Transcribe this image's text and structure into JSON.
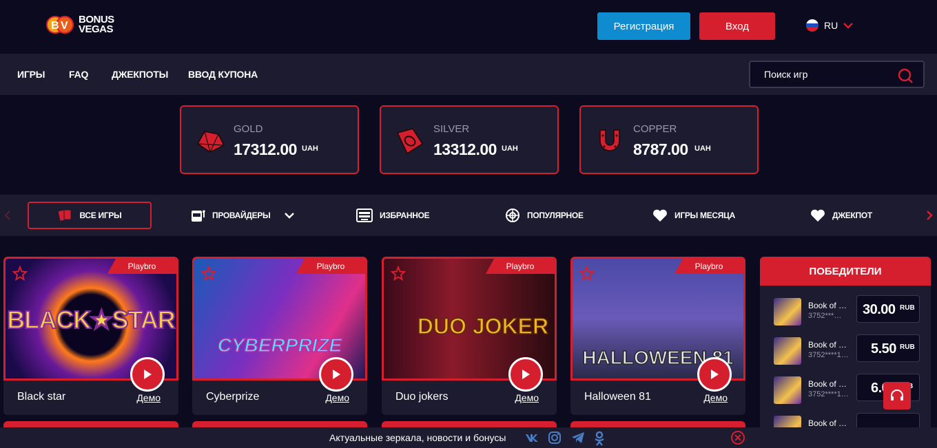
{
  "header": {
    "logo_line1": "BONUS",
    "logo_line2": "VEGAS",
    "register_label": "Регистрация",
    "login_label": "Вход",
    "language": "RU"
  },
  "nav": {
    "items": [
      "ИГРЫ",
      "FAQ",
      "ДЖЕКПОТЫ",
      "ВВОД КУПОНА"
    ],
    "search_placeholder": "Поиск игр"
  },
  "jackpots": [
    {
      "label": "GOLD",
      "value": "17312.00",
      "currency": "UAH",
      "icon": "diamond-icon"
    },
    {
      "label": "SILVER",
      "value": "13312.00",
      "currency": "UAH",
      "icon": "ring-icon"
    },
    {
      "label": "COPPER",
      "value": "8787.00",
      "currency": "UAH",
      "icon": "horseshoe-icon"
    }
  ],
  "categories": [
    {
      "label": "ВСЕ ИГРЫ",
      "icon": "cards-icon",
      "active": true
    },
    {
      "label": "ПРОВАЙДЕРЫ",
      "icon": "slot-machine-icon"
    },
    {
      "label": "ИЗБРАННОЕ",
      "icon": "keyboard-icon"
    },
    {
      "label": "ПОПУЛЯРНОЕ",
      "icon": "globe-icon"
    },
    {
      "label": "ИГРЫ МЕСЯЦА",
      "icon": "heart-icon"
    },
    {
      "label": "ДЖЕКПОТ",
      "icon": "heart-icon"
    }
  ],
  "games": [
    {
      "name": "Black star",
      "provider": "Playbro",
      "demo": "Демо",
      "art_text": "BLACK★STAR",
      "art_color": "#f5d34a"
    },
    {
      "name": "Cyberprize",
      "provider": "Playbro",
      "demo": "Демо",
      "art_text": "CYBERPRIZE",
      "art_color": "#4fe3ff"
    },
    {
      "name": "Duo jokers",
      "provider": "Playbro",
      "demo": "Демо",
      "art_text": "DUO JOKER",
      "art_color": "#f2b628"
    },
    {
      "name": "Halloween 81",
      "provider": "Playbro",
      "demo": "Демо",
      "art_text": "HALLOWEEN 81",
      "art_color": "#e8e8e8"
    }
  ],
  "winners": {
    "title": "ПОБЕДИТЕЛИ",
    "rows": [
      {
        "game": "Book of …",
        "user": "3752***…",
        "amount": "30.00",
        "currency": "RUB"
      },
      {
        "game": "Book of Su…",
        "user": "3752****1…",
        "amount": "5.50",
        "currency": "RUB"
      },
      {
        "game": "Book of S…",
        "user": "3752****1…",
        "amount": "6.0",
        "currency": "B"
      },
      {
        "game": "Book of S…",
        "user": "",
        "amount": "",
        "currency": ""
      }
    ]
  },
  "footer": {
    "text": "Актуальные зеркала, новости и бонусы",
    "social": [
      "vk-icon",
      "instagram-icon",
      "telegram-icon",
      "odnoklassniki-icon"
    ]
  },
  "colors": {
    "accent": "#d51f2e",
    "primary_blue": "#0f8ccf",
    "bg": "#0c0a1f",
    "panel": "#1d1b30"
  }
}
